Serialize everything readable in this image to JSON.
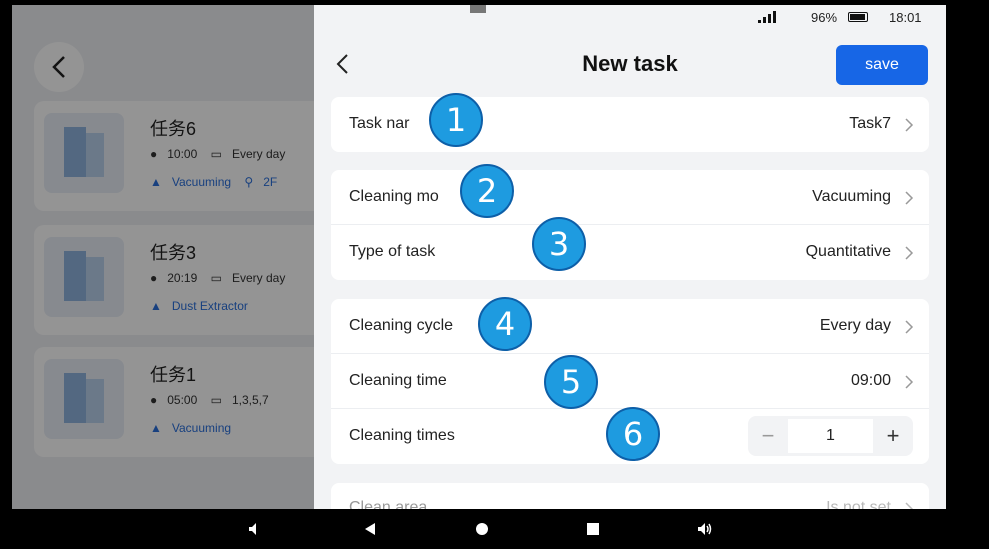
{
  "background": {
    "cards": [
      {
        "title": "任务6",
        "time": "10:00",
        "repeat": "Every day",
        "mode": "Vacuuming",
        "floor": "2F"
      },
      {
        "title": "任务3",
        "time": "20:19",
        "repeat": "Every day",
        "mode": "Dust Extractor",
        "floor": ""
      },
      {
        "title": "任务1",
        "time": "05:00",
        "repeat": "1,3,5,7",
        "mode": "Vacuuming",
        "floor": ""
      }
    ]
  },
  "status": {
    "battery": "96%",
    "time": "18:01"
  },
  "header": {
    "title": "New task",
    "save_label": "save"
  },
  "groups": {
    "task": {
      "name_label": "Task nar",
      "name_value": "Task7"
    },
    "mode": {
      "cleaning_mode_label": "Cleaning mo",
      "cleaning_mode_value": "Vacuuming",
      "type_label": "Type of task",
      "type_value": "Quantitative"
    },
    "schedule": {
      "cycle_label": "Cleaning cycle",
      "cycle_value": "Every day",
      "time_label": "Cleaning time",
      "time_value": "09:00",
      "times_label": "Cleaning times",
      "times_value": "1",
      "minus": "−",
      "plus": "+"
    },
    "area": {
      "label": "Clean area",
      "value": "Is not set"
    }
  },
  "badges": [
    "1",
    "2",
    "3",
    "4",
    "5",
    "6"
  ],
  "colors": {
    "accent": "#1766e6",
    "badge": "#1e9be0"
  }
}
